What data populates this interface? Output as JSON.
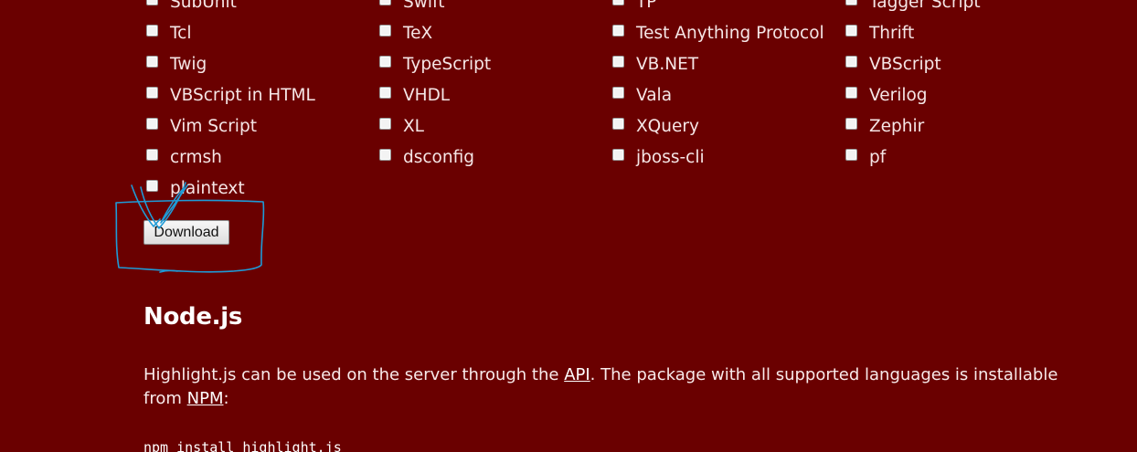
{
  "languages": {
    "rows": [
      [
        "SubUnit",
        "Swift",
        "TP",
        "Tagger Script"
      ],
      [
        "Tcl",
        "TeX",
        "Test Anything Protocol",
        "Thrift"
      ],
      [
        "Twig",
        "TypeScript",
        "VB.NET",
        "VBScript"
      ],
      [
        "VBScript in HTML",
        "VHDL",
        "Vala",
        "Verilog"
      ],
      [
        "Vim Script",
        "XL",
        "XQuery",
        "Zephir"
      ],
      [
        "crmsh",
        "dsconfig",
        "jboss-cli",
        "pf"
      ],
      [
        "plaintext"
      ]
    ]
  },
  "download_button": {
    "label": "Download"
  },
  "annotation": {
    "color": "#1e9bd7"
  },
  "nodejs": {
    "title": "Node.js",
    "text_before_api": "Highlight.js can be used on the server through the ",
    "api_link": "API",
    "text_after_api": ". The package with all supported languages is installable from ",
    "npm_link": "NPM",
    "text_end": ":",
    "code": "npm install highlight.js"
  },
  "colors": {
    "background": "#6a0000",
    "text": "#f5e6e6"
  }
}
